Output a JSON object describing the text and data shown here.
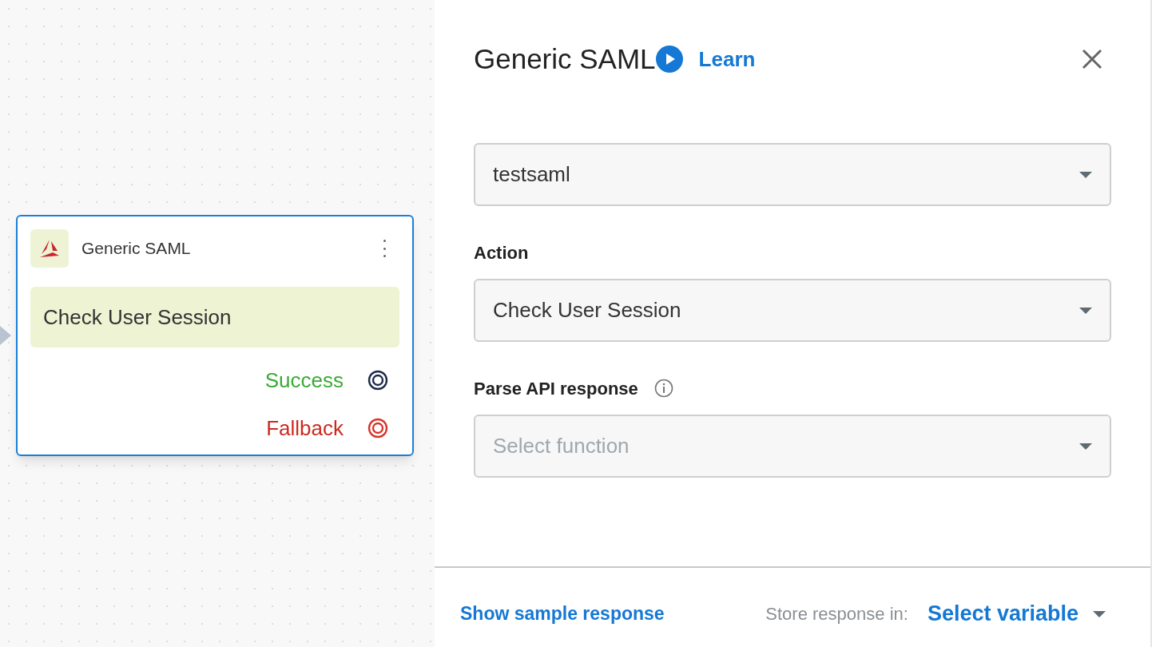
{
  "node": {
    "title": "Generic SAML",
    "action": "Check User Session",
    "outputs": [
      {
        "label": "Success",
        "kind": "success"
      },
      {
        "label": "Fallback",
        "kind": "fallback"
      }
    ]
  },
  "panel": {
    "title": "Generic SAML",
    "learn_link": "Learn",
    "fields": [
      {
        "value": "testsaml"
      },
      {
        "label": "Action",
        "value": "Check User Session"
      },
      {
        "label": "Parse API response",
        "info": true,
        "placeholder": "Select function"
      }
    ],
    "footer": {
      "sample_link": "Show sample response",
      "store_label": "Store response in:",
      "variable_select": "Select variable"
    }
  }
}
